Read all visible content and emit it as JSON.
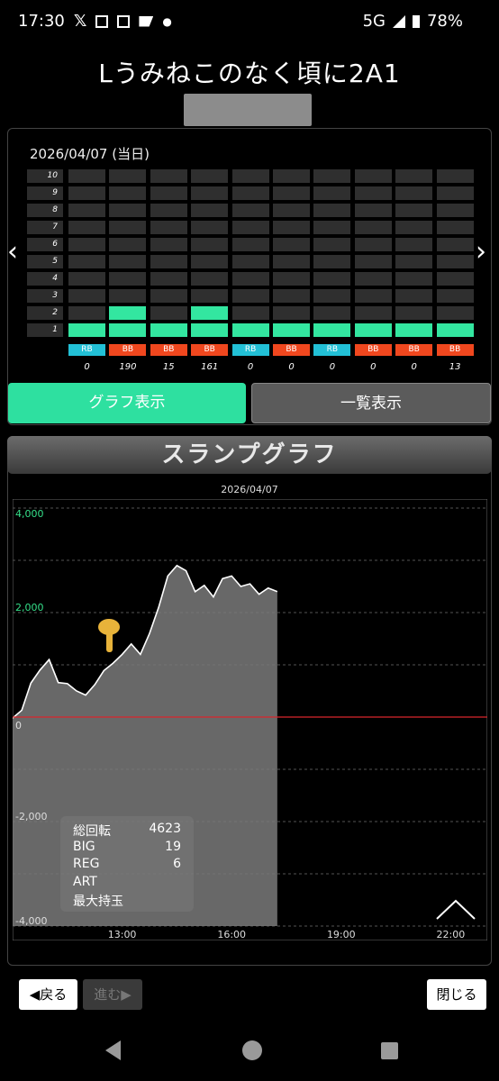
{
  "status_bar": {
    "time": "17:30",
    "icons": [
      "x-icon",
      "news-icon",
      "news-icon",
      "app-icon",
      "dot"
    ],
    "network": "5G",
    "battery": "78%"
  },
  "header": {
    "title": "Lうみねこのなく頃に2A1"
  },
  "calendar": {
    "date_label": "2026/04/07 (当日)",
    "row_labels": [
      "10",
      "9",
      "8",
      "7",
      "6",
      "5",
      "4",
      "3",
      "2",
      "1"
    ],
    "columns": [
      {
        "level": 1,
        "type": "RB",
        "value": "0"
      },
      {
        "level": 2,
        "type": "BB",
        "value": "190"
      },
      {
        "level": 1,
        "type": "BB",
        "value": "15"
      },
      {
        "level": 2,
        "type": "BB",
        "value": "161"
      },
      {
        "level": 1,
        "type": "RB",
        "value": "0"
      },
      {
        "level": 1,
        "type": "BB",
        "value": "0"
      },
      {
        "level": 1,
        "type": "RB",
        "value": "0"
      },
      {
        "level": 1,
        "type": "BB",
        "value": "0"
      },
      {
        "level": 1,
        "type": "BB",
        "value": "0"
      },
      {
        "level": 1,
        "type": "BB",
        "value": "13"
      }
    ],
    "prev_arrow": "‹",
    "next_arrow": "›"
  },
  "tabs": {
    "graph": "グラフ表示",
    "list": "一覧表示"
  },
  "slump": {
    "title": "スランプグラフ",
    "date": "2026/04/07",
    "stats": [
      {
        "label": "総回転",
        "value": "4623"
      },
      {
        "label": "BIG",
        "value": "19"
      },
      {
        "label": "REG",
        "value": "6"
      },
      {
        "label": "ART",
        "value": ""
      },
      {
        "label": "最大持玉",
        "value": ""
      }
    ]
  },
  "chart_data": {
    "type": "area",
    "x_ticks": [
      "13:00",
      "16:00",
      "19:00",
      "22:00"
    ],
    "y_ticks": [
      "4,000",
      "2,000",
      "0",
      "-2,000",
      "-4,000"
    ],
    "ylim": [
      -4000,
      4000
    ],
    "grid": true,
    "zero_line_color": "#d9262c",
    "positive_tick_color": "#35e08a",
    "fill_color": "#7a7a7a",
    "x": [
      "10:00",
      "10:15",
      "10:30",
      "10:45",
      "11:00",
      "11:15",
      "11:30",
      "11:45",
      "12:00",
      "12:15",
      "12:30",
      "12:45",
      "13:00",
      "13:15",
      "13:30",
      "13:45",
      "14:00",
      "14:15",
      "14:30",
      "14:45",
      "15:00",
      "15:15",
      "15:30",
      "15:45",
      "16:00",
      "16:15",
      "16:30",
      "16:45",
      "17:00",
      "17:15"
    ],
    "y": [
      -20,
      130,
      650,
      900,
      1100,
      660,
      640,
      500,
      420,
      620,
      890,
      1030,
      1200,
      1400,
      1200,
      1600,
      2100,
      2700,
      2900,
      2800,
      2400,
      2520,
      2300,
      2650,
      2700,
      2500,
      2550,
      2350,
      2470,
      2400
    ]
  },
  "footer": {
    "back": "◀戻る",
    "forward": "進む▶",
    "close": "閉じる"
  },
  "colors": {
    "accent_green": "#2ee0a0",
    "rb": "#22c0d6",
    "bb": "#f0471e"
  }
}
